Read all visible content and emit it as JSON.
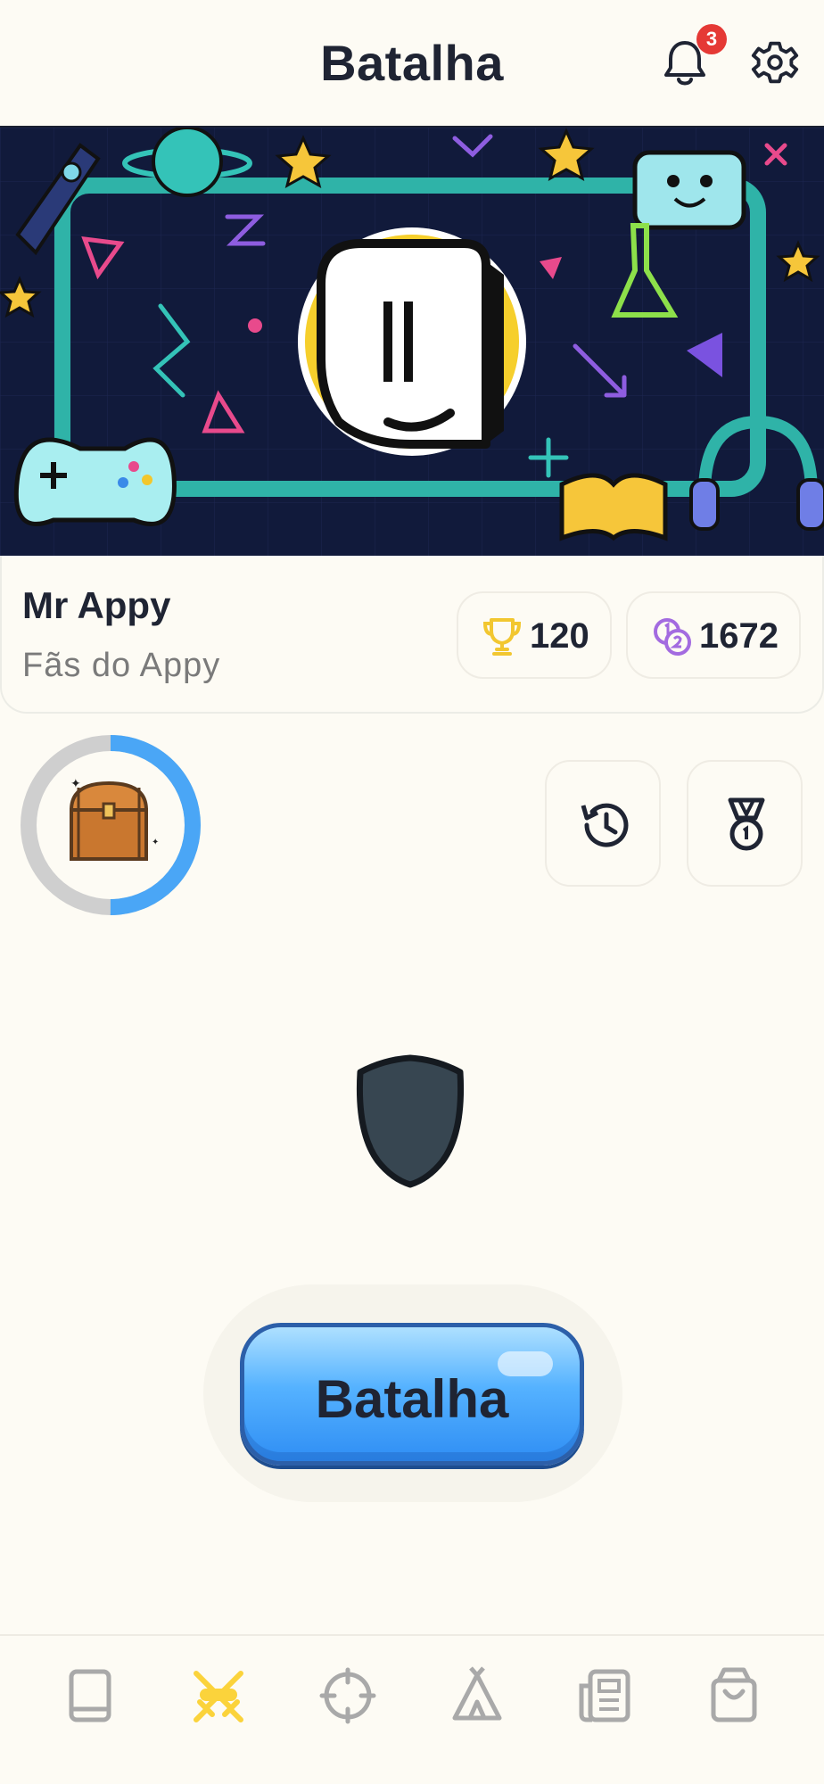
{
  "header": {
    "title": "Batalha",
    "notification_count": "3"
  },
  "profile": {
    "name": "Mr Appy",
    "clan": "Fãs do Appy",
    "trophies": "120",
    "coins": "1672"
  },
  "battle": {
    "button_label": "Batalha"
  },
  "chest": {
    "progress": 0.5
  },
  "bottom_nav": {
    "items": [
      {
        "icon": "book-icon",
        "active": false
      },
      {
        "icon": "crossed-swords-icon",
        "active": true
      },
      {
        "icon": "crosshair-icon",
        "active": false
      },
      {
        "icon": "tent-icon",
        "active": false
      },
      {
        "icon": "newspaper-icon",
        "active": false
      },
      {
        "icon": "shopping-bag-icon",
        "active": false
      }
    ]
  },
  "colors": {
    "background": "#fdfbf4",
    "text": "#1f2433",
    "accent_yellow": "#fbd33b",
    "battle_blue": "#3a96f8",
    "badge_red": "#e53935",
    "coin_purple": "#a36be0"
  }
}
